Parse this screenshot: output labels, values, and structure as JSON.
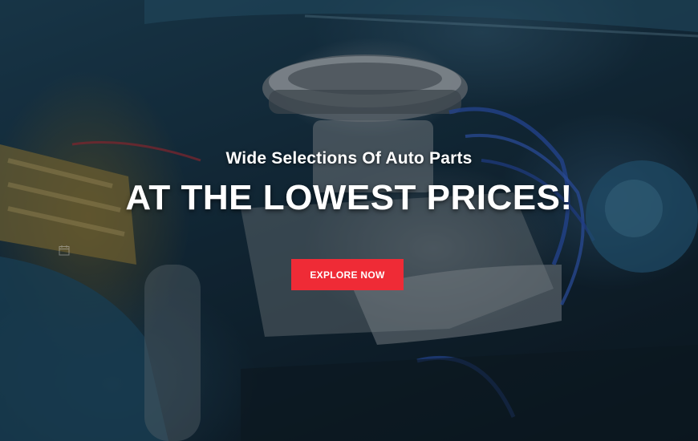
{
  "hero": {
    "subtitle": "Wide Selections Of Auto Parts",
    "headline": "AT THE LOWEST PRICES!",
    "cta_label": "EXPLORE NOW"
  },
  "colors": {
    "accent": "#ef2b36",
    "text": "#ffffff"
  },
  "icons": [
    "calendar-icon"
  ]
}
